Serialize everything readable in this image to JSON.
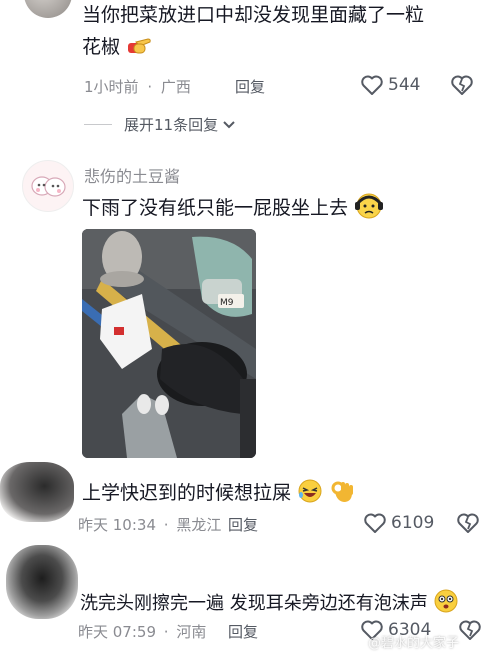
{
  "comments": [
    {
      "text_line1": "当你把菜放进口中却没发现里面藏了一粒",
      "text_line2": "花椒",
      "emoji_icon": "point-finger-icon",
      "time": "1小时前",
      "location": "广西",
      "reply_label": "回复",
      "like_count": "544"
    },
    {
      "username": "悲伤的土豆酱",
      "text": "下雨了没有纸只能一屁股坐上去",
      "emoji_icon": "sad-face-icon",
      "image_sticker_text": "M9"
    },
    {
      "text": "上学快迟到的时候想拉屎",
      "emoji_icons": [
        "laughing-face-icon",
        "ok-hand-icon"
      ],
      "time": "昨天 10:34",
      "location": "黑龙江",
      "reply_label": "回复",
      "like_count": "6109"
    },
    {
      "text": "洗完头刚擦完一遍 发现耳朵旁边还有泡沫声",
      "emoji_icon": "dizzy-face-icon",
      "time": "昨天 07:59",
      "location": "河南",
      "reply_label": "回复",
      "like_count": "6304"
    }
  ],
  "expand_replies": "展开11条回复",
  "separator": "·",
  "watermark": "@碧水的大家子",
  "colors": {
    "text": "#161823",
    "meta": "#8a8b91",
    "bg": "#ffffff"
  }
}
